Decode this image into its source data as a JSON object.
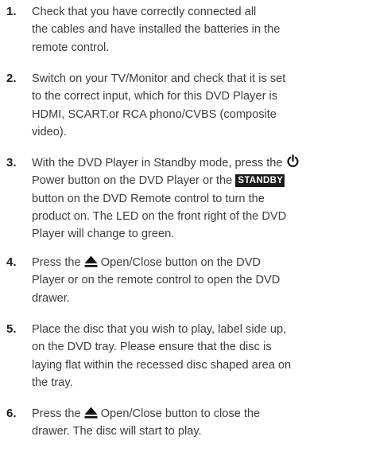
{
  "steps": [
    {
      "number": "1.",
      "lines": [
        "Check that you have correctly connected all",
        "the cables and have installed the batteries in the",
        "remote control."
      ]
    },
    {
      "number": "2.",
      "lines": [
        "Switch on your TV/Monitor and check that it is set",
        "to the correct input, which for this DVD Player is",
        "HDMI, SCART.or RCA phono/CVBS (composite",
        "video)."
      ]
    },
    {
      "number": "3.",
      "line1_text": "With the DVD Player in Standby mode, press the",
      "line2_text": "Power button on the DVD Player or the",
      "standby_label": "STANDBY",
      "lines_rest": [
        "button on the DVD Remote control to turn the",
        "product on. The LED on the front right of the DVD",
        "Player will change to green."
      ]
    },
    {
      "number": "4.",
      "line1_pre": "Press the",
      "line1_post": "Open/Close button on the DVD",
      "lines_rest": [
        "Player or on the remote control to open the DVD",
        "drawer."
      ]
    },
    {
      "number": "5.",
      "lines": [
        "Place the disc that you wish to play, label side up,",
        "on the DVD tray. Please ensure that the disc is",
        "laying flat within the recessed disc shaped area on",
        "the tray."
      ]
    },
    {
      "number": "6.",
      "line1_pre": "Press the",
      "line1_post": "Open/Close button to close the",
      "lines_rest": [
        "drawer. The disc will start to play."
      ]
    }
  ],
  "icons": {
    "power": "power-icon",
    "eject": "eject-icon"
  }
}
